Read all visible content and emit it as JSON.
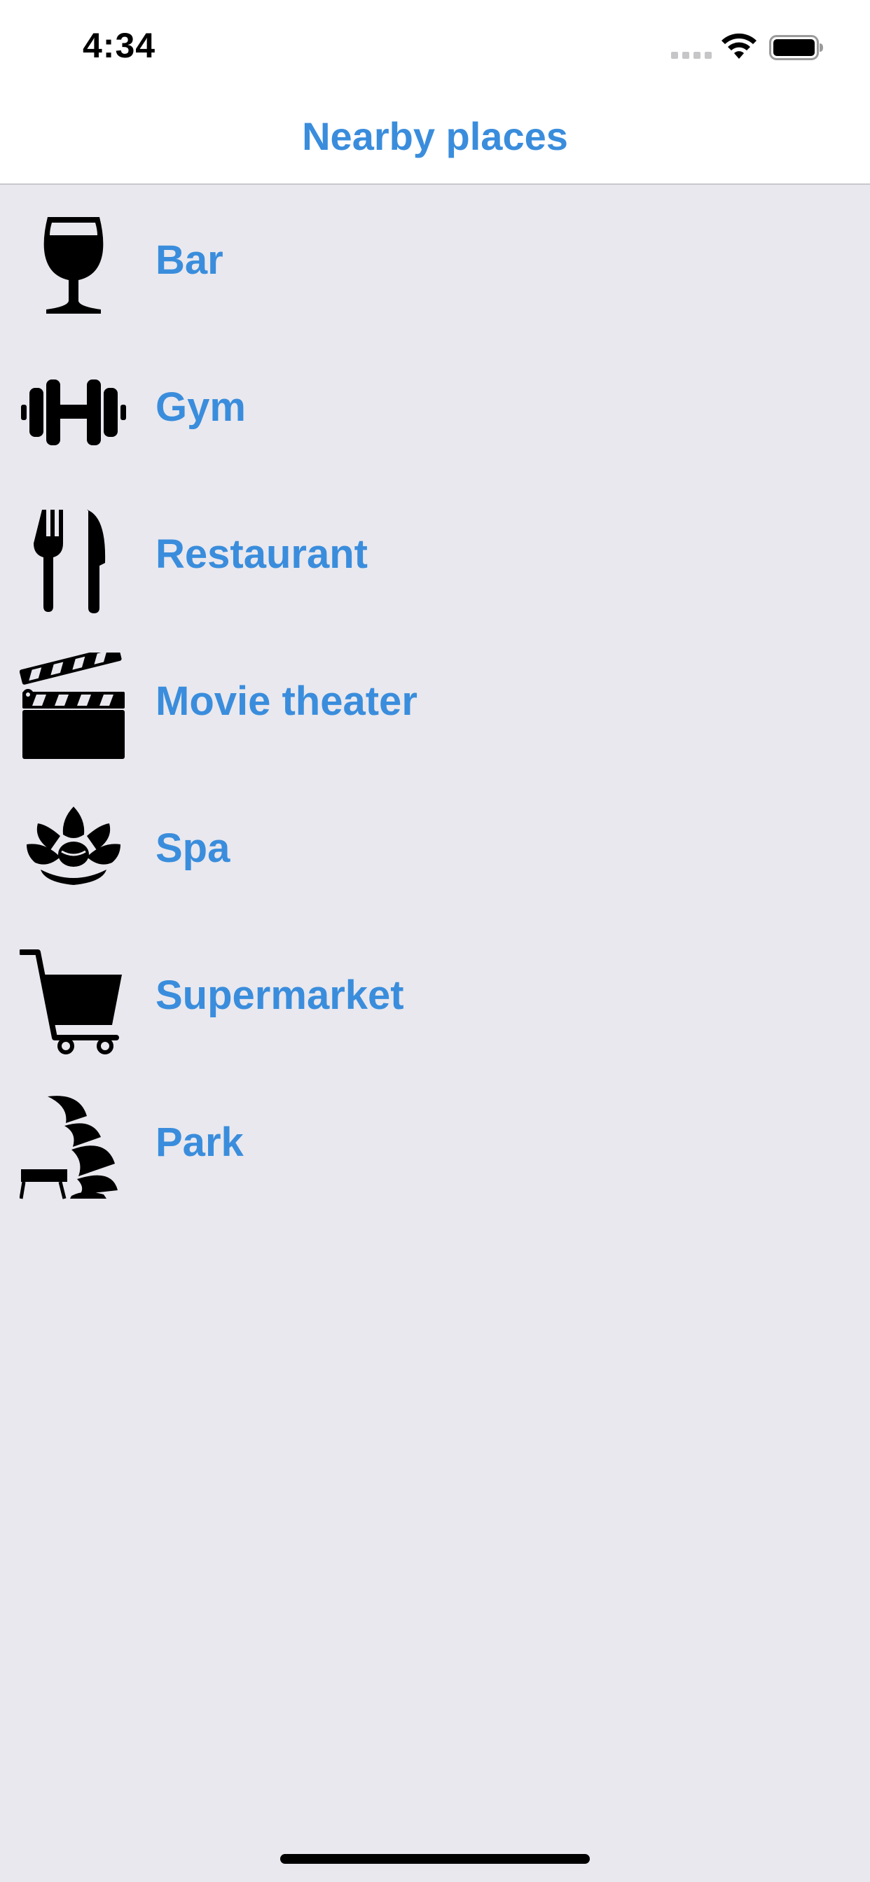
{
  "status_bar": {
    "time": "4:34",
    "signal_icon": "cellular-signal-icon",
    "wifi_icon": "wifi-icon",
    "battery_icon": "battery-icon"
  },
  "nav": {
    "title": "Nearby places"
  },
  "places": [
    {
      "label": "Bar",
      "icon": "wine-glass-icon"
    },
    {
      "label": "Gym",
      "icon": "dumbbell-icon"
    },
    {
      "label": "Restaurant",
      "icon": "fork-knife-icon"
    },
    {
      "label": "Movie theater",
      "icon": "clapperboard-icon"
    },
    {
      "label": "Spa",
      "icon": "lotus-icon"
    },
    {
      "label": "Supermarket",
      "icon": "shopping-cart-icon"
    },
    {
      "label": "Park",
      "icon": "park-bench-tree-icon"
    }
  ],
  "colors": {
    "accent": "#3a8ddc",
    "background": "#e9e8ee",
    "bar_background": "#ffffff"
  }
}
